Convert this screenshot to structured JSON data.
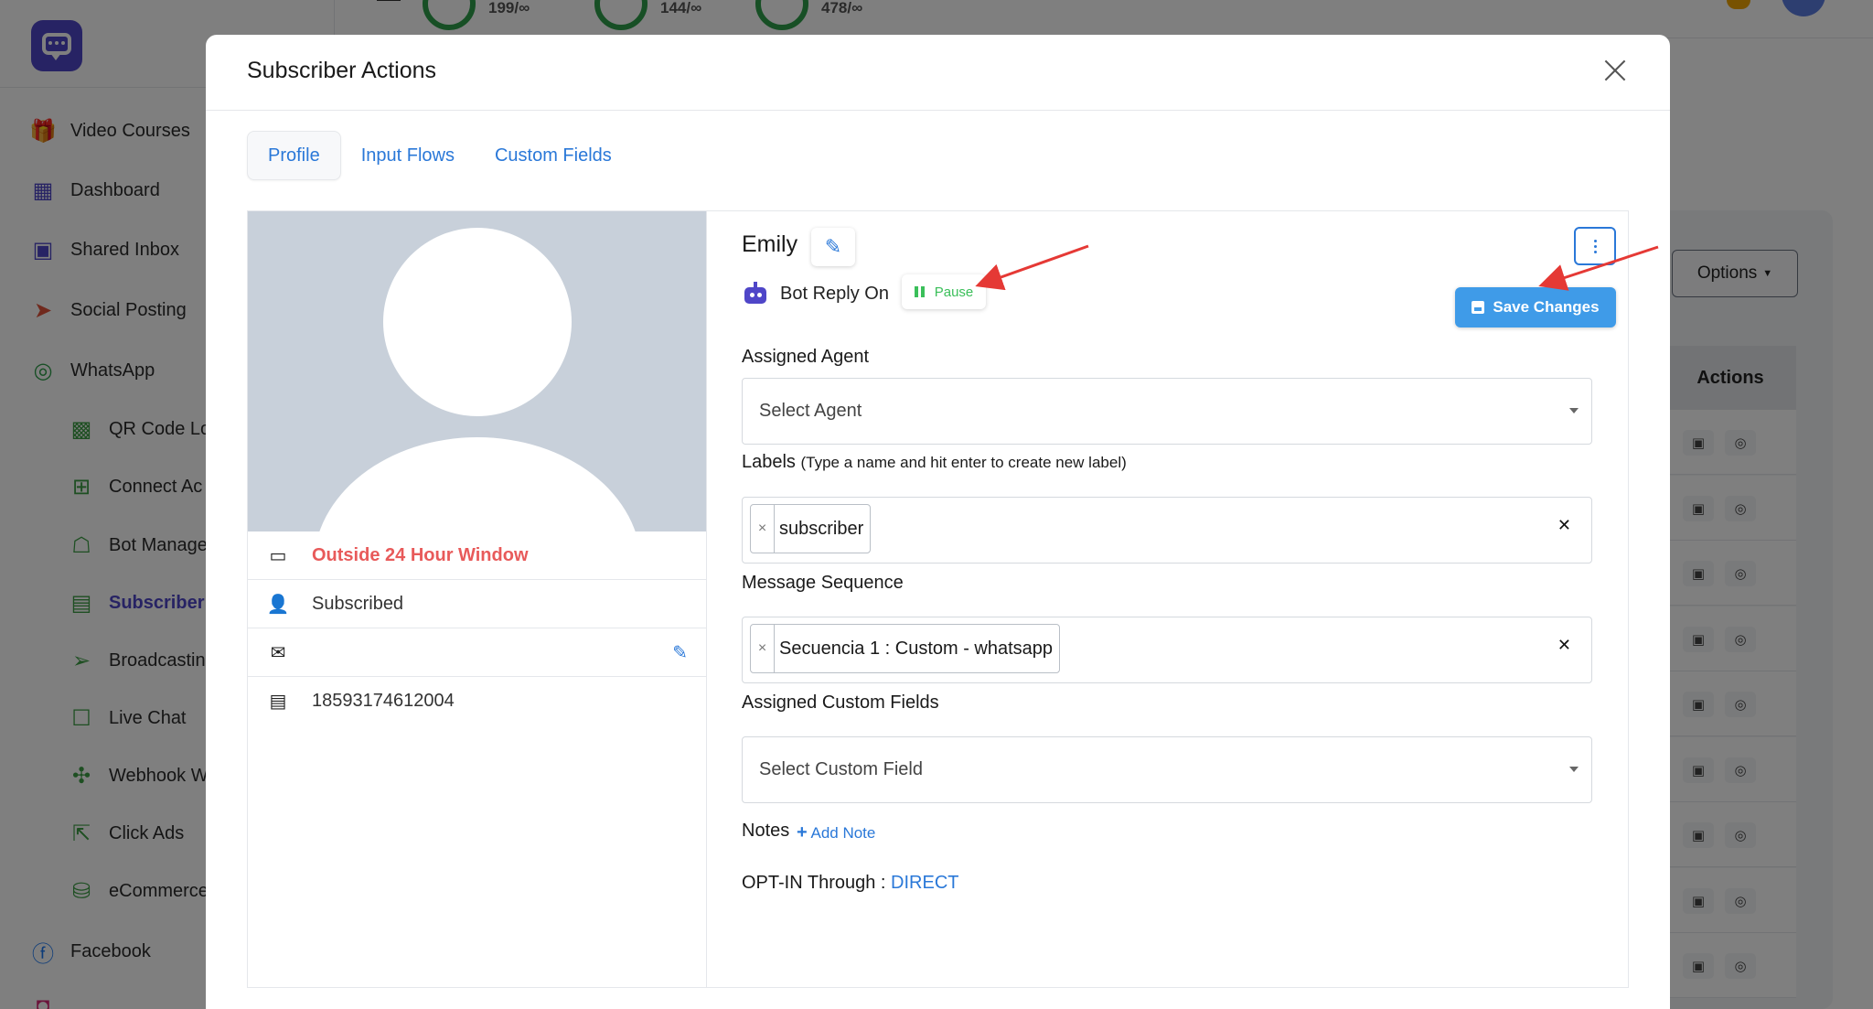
{
  "sidebar": {
    "items": [
      {
        "label": "Video Courses",
        "icon": "gift-icon"
      },
      {
        "label": "Dashboard",
        "icon": "grid-icon"
      },
      {
        "label": "Shared Inbox",
        "icon": "inbox-icon"
      },
      {
        "label": "Social Posting",
        "icon": "paper-plane-icon"
      },
      {
        "label": "WhatsApp",
        "icon": "whatsapp-icon"
      },
      {
        "label": "QR Code Lo",
        "icon": "qr-code-icon"
      },
      {
        "label": "Connect Ac",
        "icon": "plus-square-icon"
      },
      {
        "label": "Bot Manage",
        "icon": "robot-icon"
      },
      {
        "label": "Subscriber",
        "icon": "id-card-icon"
      },
      {
        "label": "Broadcastin",
        "icon": "paper-plane-icon"
      },
      {
        "label": "Live Chat",
        "icon": "chat-icon"
      },
      {
        "label": "Webhook W",
        "icon": "puzzle-icon"
      },
      {
        "label": "Click Ads",
        "icon": "cursor-icon"
      },
      {
        "label": "eCommerce",
        "icon": "shopping-bag-icon"
      },
      {
        "label": "Facebook",
        "icon": "facebook-icon"
      }
    ]
  },
  "topbar": {
    "stats": [
      "199/∞",
      "144/∞",
      "478/∞"
    ]
  },
  "background": {
    "options_label": "Options",
    "actions_header": "Actions",
    "rows": 9
  },
  "modal": {
    "title": "Subscriber Actions",
    "tabs": [
      {
        "label": "Profile",
        "active": true
      },
      {
        "label": "Input Flows",
        "active": false
      },
      {
        "label": "Custom Fields",
        "active": false
      }
    ],
    "profile": {
      "window_status": "Outside 24 Hour Window",
      "subscription": "Subscribed",
      "email": "",
      "phone": "18593174612004"
    },
    "name": "Emily",
    "bot_reply": "Bot Reply On",
    "pause_label": "Pause",
    "save_label": "Save Changes",
    "assigned_agent": {
      "label": "Assigned Agent",
      "placeholder": "Select Agent"
    },
    "labels": {
      "label": "Labels",
      "hint": "(Type a name and hit enter to create new label)",
      "tags": [
        "subscriber"
      ]
    },
    "message_sequence": {
      "label": "Message Sequence",
      "tags": [
        "Secuencia 1 : Custom - whatsapp"
      ]
    },
    "custom_fields": {
      "label": "Assigned Custom Fields",
      "placeholder": "Select Custom Field"
    },
    "notes": {
      "label": "Notes",
      "add_label": "Add Note"
    },
    "optin": {
      "label": "OPT-IN Through :",
      "value": "DIRECT"
    }
  },
  "colors": {
    "brand": "#4f46c8",
    "link": "#2a78d8",
    "primary_button": "#3f9be8",
    "warning_text": "#e85a5a",
    "pause_green": "#3bbf5a",
    "annotation_arrow": "#e53935"
  }
}
